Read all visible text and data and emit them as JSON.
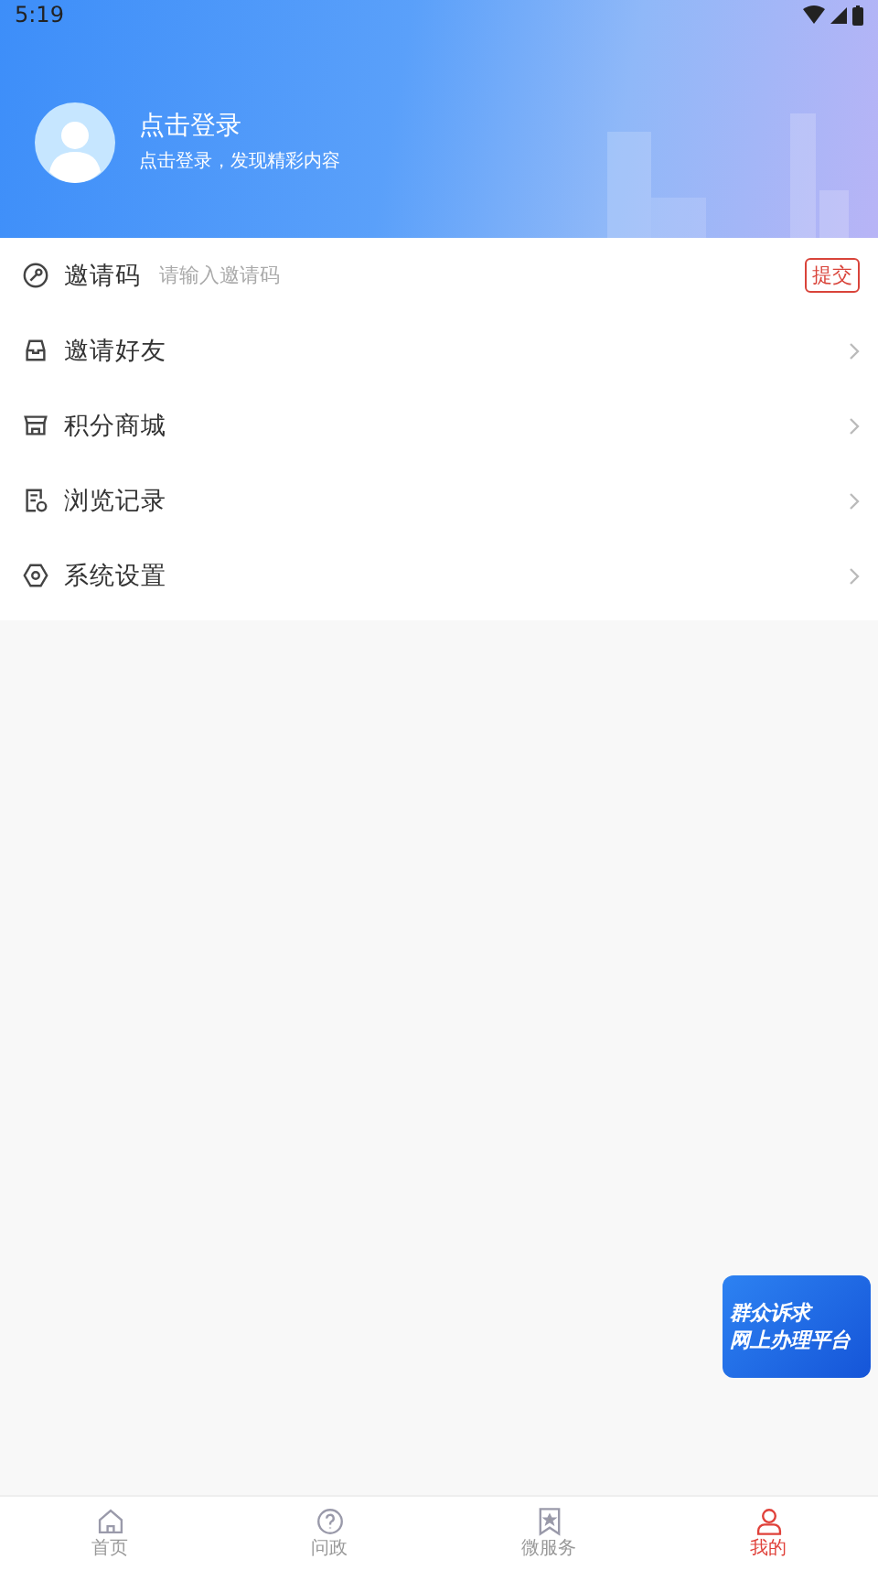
{
  "status_bar": {
    "time": "5:19"
  },
  "profile": {
    "name": "点击登录",
    "subtitle": "点击登录，发现精彩内容"
  },
  "menu": [
    {
      "kind": "input",
      "label": "邀请码",
      "placeholder": "请输入邀请码",
      "action": "提交"
    },
    {
      "kind": "link",
      "label": "邀请好友"
    },
    {
      "kind": "link",
      "label": "积分商城"
    },
    {
      "kind": "link",
      "label": "浏览记录"
    },
    {
      "kind": "link",
      "label": "系统设置"
    }
  ],
  "floating_banner": {
    "lines": [
      "群众诉求",
      "网上办理平台"
    ]
  },
  "bottom_nav": [
    {
      "label": "首页",
      "selected": false
    },
    {
      "label": "问政",
      "selected": false
    },
    {
      "label": "微服务",
      "selected": false
    },
    {
      "label": "我的",
      "selected": true
    }
  ]
}
